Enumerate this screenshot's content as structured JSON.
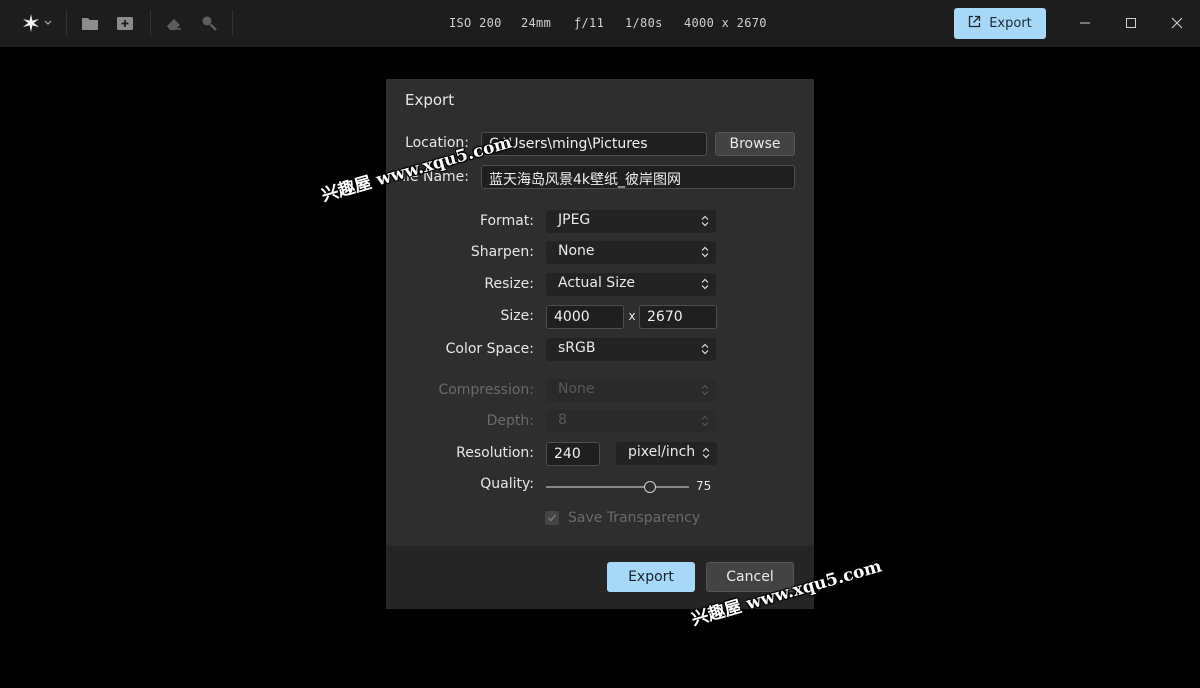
{
  "toolbar": {
    "exif": {
      "iso": "ISO 200",
      "focal": "24mm",
      "aperture": "ƒ/11",
      "shutter": "1/80s",
      "dimensions": "4000 x 2670"
    },
    "export_label": "Export"
  },
  "dialog": {
    "title": "Export",
    "location_label": "Location:",
    "location_value": "C:\\Users\\ming\\Pictures",
    "browse_label": "Browse",
    "filename_label": "File Name:",
    "filename_value": "蓝天海岛风景4k壁纸_彼岸图网",
    "format_label": "Format:",
    "format_value": "JPEG",
    "sharpen_label": "Sharpen:",
    "sharpen_value": "None",
    "resize_label": "Resize:",
    "resize_value": "Actual Size",
    "size_label": "Size:",
    "size_width": "4000",
    "size_x": "x",
    "size_height": "2670",
    "colorspace_label": "Color Space:",
    "colorspace_value": "sRGB",
    "compression_label": "Compression:",
    "compression_value": "None",
    "depth_label": "Depth:",
    "depth_value": "8",
    "resolution_label": "Resolution:",
    "resolution_value": "240",
    "resolution_unit": "pixel/inch",
    "quality_label": "Quality:",
    "quality_value": "75",
    "quality_fraction": 0.75,
    "transparency_label": "Save Transparency",
    "export_button": "Export",
    "cancel_button": "Cancel"
  },
  "watermarks": {
    "top": "兴趣屋 www.xqu5.com",
    "bottom": "兴趣屋 www.xqu5.com"
  },
  "colors": {
    "accent": "#a8d8f7",
    "dialog_bg": "#2e2e2e",
    "topbar_bg": "#1d1d1d"
  }
}
